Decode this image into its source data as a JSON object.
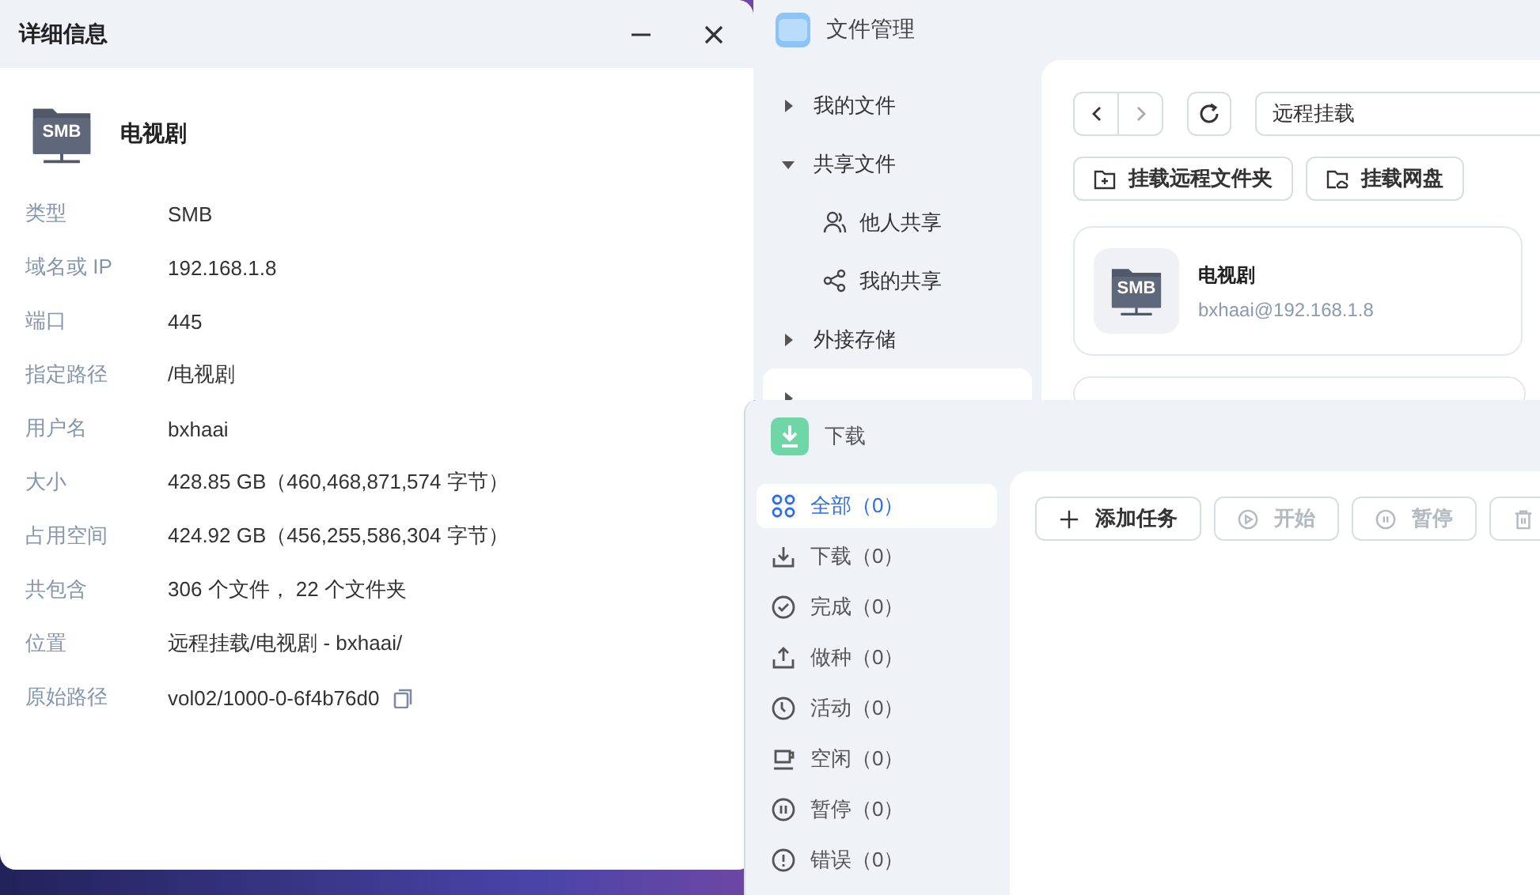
{
  "details_window": {
    "title": "详细信息",
    "badge": "SMB",
    "name": "电视剧",
    "fields": [
      {
        "label": "类型",
        "value": "SMB",
        "kind": "text"
      },
      {
        "label": "域名或 IP",
        "value": "192.168.1.8",
        "kind": "text"
      },
      {
        "label": "端口",
        "value": "445",
        "kind": "text"
      },
      {
        "label": "指定路径",
        "value": "/电视剧",
        "kind": "text"
      },
      {
        "label": "用户名",
        "value": "bxhaai",
        "kind": "text"
      },
      {
        "label": "大小",
        "value": "428.85 GB（460,468,871,574 字节）",
        "kind": "text"
      },
      {
        "label": "占用空间",
        "value": "424.92 GB（456,255,586,304 字节）",
        "kind": "text"
      },
      {
        "label": "共包含",
        "value": "306 个文件， 22 个文件夹",
        "kind": "text"
      },
      {
        "label": "位置",
        "value": "远程挂载/电视剧 - bxhaai/",
        "kind": "text"
      },
      {
        "label": "原始路径",
        "value": "vol02/1000-0-6f4b76d0",
        "kind": "copyable"
      }
    ]
  },
  "file_manager": {
    "title": "文件管理",
    "sidebar": {
      "items": [
        {
          "label": "我的文件",
          "expanded": false,
          "selected": false
        },
        {
          "label": "共享文件",
          "expanded": true,
          "selected": false,
          "children": [
            {
              "label": "他人共享",
              "kind": "people",
              "selected": false
            },
            {
              "label": "我的共享",
              "kind": "share",
              "selected": false
            }
          ]
        },
        {
          "label": "外接存储",
          "expanded": false,
          "selected": false
        },
        {
          "expanded": false,
          "selected": true
        }
      ]
    },
    "path": {
      "value": "远程挂载"
    },
    "toolbar": [
      {
        "label": "挂载远程文件夹",
        "kind": "folder"
      },
      {
        "label": "挂载网盘",
        "kind": "cloud"
      }
    ],
    "cards": [
      {
        "badge": "SMB",
        "name": "电视剧",
        "subtitle": "bxhaai@192.168.1.8"
      }
    ]
  },
  "download_window": {
    "title": "下载",
    "filters": [
      {
        "label": "全部（0）",
        "kind": "all",
        "selected": true
      },
      {
        "label": "下载（0）",
        "kind": "download",
        "selected": false
      },
      {
        "label": "完成（0）",
        "kind": "done",
        "selected": false
      },
      {
        "label": "做种（0）",
        "kind": "seed",
        "selected": false
      },
      {
        "label": "活动（0）",
        "kind": "active",
        "selected": false
      },
      {
        "label": "空闲（0）",
        "kind": "idle",
        "selected": false
      },
      {
        "label": "暂停（0）",
        "kind": "paused",
        "selected": false
      },
      {
        "label": "错误（0）",
        "kind": "error",
        "selected": false
      }
    ],
    "toolbar": [
      {
        "label": "添加任务",
        "kind": "add",
        "disabled": false
      },
      {
        "label": "开始",
        "kind": "start",
        "disabled": true
      },
      {
        "label": "暂停",
        "kind": "pause",
        "disabled": true
      },
      {
        "kind": "delete",
        "disabled": true
      }
    ]
  }
}
